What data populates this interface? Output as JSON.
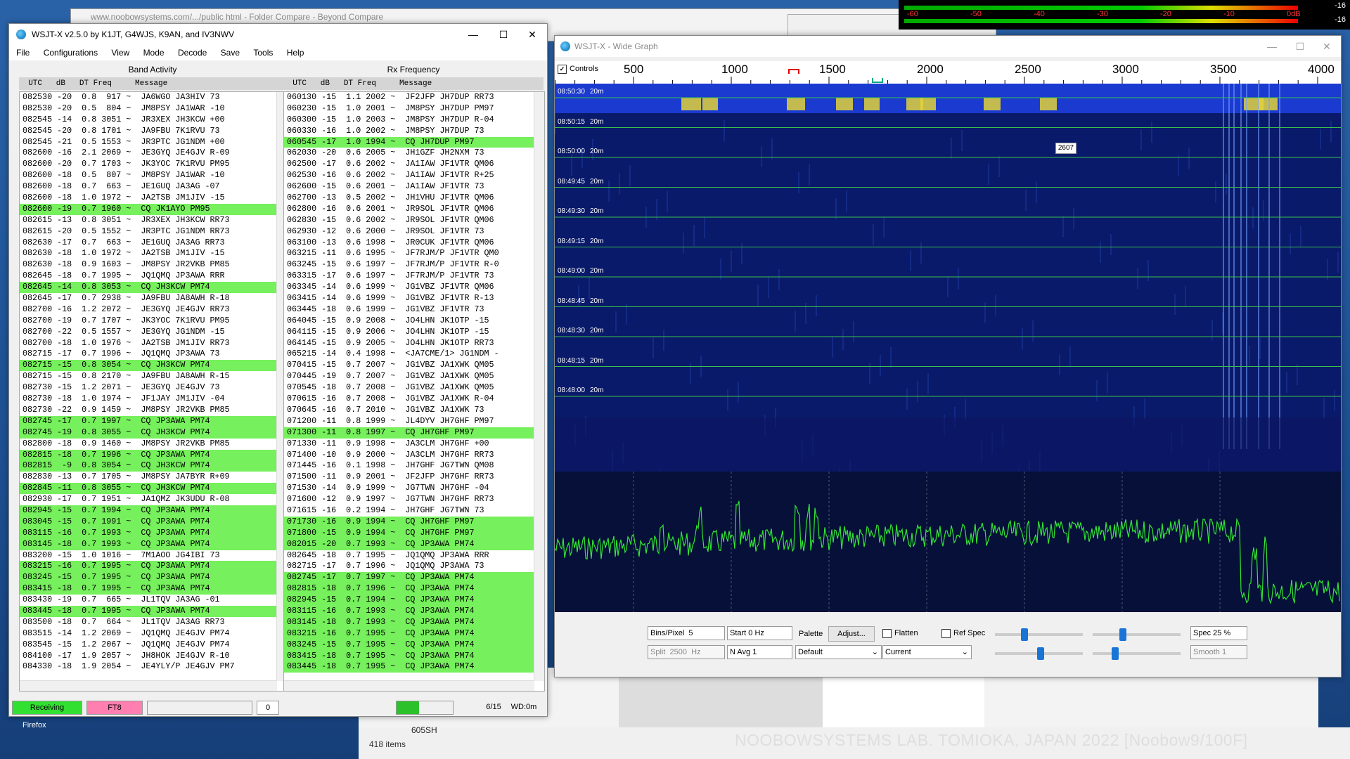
{
  "browser": {
    "title": "www.noobowsystems.com/.../public html - Folder Compare - Beyond Compare"
  },
  "meter": {
    "ticks": [
      "-60",
      "-50",
      "-40",
      "-30",
      "-20",
      "-10",
      "0dB"
    ],
    "right_top": "-16",
    "right_bottom": "-16"
  },
  "desktop": {
    "firefox_label": "Firefox",
    "folder_label": "605SH",
    "items_count": "418 items",
    "watermark": "NOOBOWSYSTEMS LAB. TOMIOKA, JAPAN 2022 [Noobow9/100F]"
  },
  "main": {
    "title": "WSJT-X   v2.5.0   by K1JT, G4WJS, K9AN, and IV3NWV",
    "controls": {
      "minimize": "—",
      "maximize": "☐",
      "close": "✕"
    },
    "menu": [
      "File",
      "Configurations",
      "View",
      "Mode",
      "Decode",
      "Save",
      "Tools",
      "Help"
    ],
    "band_activity_label": "Band Activity",
    "rx_frequency_label": "Rx Frequency",
    "col_header": "  UTC   dB   DT Freq     Message",
    "band_rows": [
      {
        "t": "082530 -20  0.8  917 ~  JA6WGO JA3HIV 73",
        "h": false
      },
      {
        "t": "082530 -20  0.5  804 ~  JM8PSY JA1WAR -10",
        "h": false
      },
      {
        "t": "082545 -14  0.8 3051 ~  JR3XEX JH3KCW +00",
        "h": false
      },
      {
        "t": "082545 -20  0.8 1701 ~  JA9FBU 7K1RVU 73",
        "h": false
      },
      {
        "t": "082545 -21  0.5 1553 ~  JR3PTC JG1NDM +00",
        "h": false
      },
      {
        "t": "082600 -16  2.1 2069 ~  JE3GYQ JE4GJV R-09",
        "h": false
      },
      {
        "t": "082600 -20  0.7 1703 ~  JK3YOC 7K1RVU PM95",
        "h": false
      },
      {
        "t": "082600 -18  0.5  807 ~  JM8PSY JA1WAR -10",
        "h": false
      },
      {
        "t": "082600 -18  0.7  663 ~  JE1GUQ JA3AG -07",
        "h": false
      },
      {
        "t": "082600 -18  1.0 1972 ~  JA2TSB JM1JIV -15",
        "h": false
      },
      {
        "t": "082600 -19  0.7 1960 ~  CQ JK1AYO PM95",
        "h": true
      },
      {
        "t": "082615 -13  0.8 3051 ~  JR3XEX JH3KCW RR73",
        "h": false
      },
      {
        "t": "082615 -20  0.5 1552 ~  JR3PTC JG1NDM RR73",
        "h": false
      },
      {
        "t": "082630 -17  0.7  663 ~  JE1GUQ JA3AG RR73",
        "h": false
      },
      {
        "t": "082630 -18  1.0 1972 ~  JA2TSB JM1JIV -15",
        "h": false
      },
      {
        "t": "082630 -18  0.9 1603 ~  JM8PSY JR2VKB PM85",
        "h": false
      },
      {
        "t": "082645 -18  0.7 1995 ~  JQ1QMQ JP3AWA RRR",
        "h": false
      },
      {
        "t": "082645 -14  0.8 3053 ~  CQ JH3KCW PM74",
        "h": true
      },
      {
        "t": "082645 -17  0.7 2938 ~  JA9FBU JA8AWH R-18",
        "h": false
      },
      {
        "t": "082700 -16  1.2 2072 ~  JE3GYQ JE4GJV RR73",
        "h": false
      },
      {
        "t": "082700 -19  0.7 1707 ~  JK3YOC 7K1RVU PM95",
        "h": false
      },
      {
        "t": "082700 -22  0.5 1557 ~  JE3GYQ JG1NDM -15",
        "h": false
      },
      {
        "t": "082700 -18  1.0 1976 ~  JA2TSB JM1JIV RR73",
        "h": false
      },
      {
        "t": "082715 -17  0.7 1996 ~  JQ1QMQ JP3AWA 73",
        "h": false
      },
      {
        "t": "082715 -15  0.8 3054 ~  CQ JH3KCW PM74",
        "h": true
      },
      {
        "t": "082715 -15  0.8 2170 ~  JA9FBU JA8AWH R-15",
        "h": false
      },
      {
        "t": "082730 -15  1.2 2071 ~  JE3GYQ JE4GJV 73",
        "h": false
      },
      {
        "t": "082730 -18  1.0 1974 ~  JF1JAY JM1JIV -04",
        "h": false
      },
      {
        "t": "082730 -22  0.9 1459 ~  JM8PSY JR2VKB PM85",
        "h": false
      },
      {
        "t": "082745 -17  0.7 1997 ~  CQ JP3AWA PM74",
        "h": true
      },
      {
        "t": "082745 -19  0.8 3055 ~  CQ JH3KCW PM74",
        "h": true
      },
      {
        "t": "082800 -18  0.9 1460 ~  JM8PSY JR2VKB PM85",
        "h": false
      },
      {
        "t": "082815 -18  0.7 1996 ~  CQ JP3AWA PM74",
        "h": true
      },
      {
        "t": "082815  -9  0.8 3054 ~  CQ JH3KCW PM74",
        "h": true
      },
      {
        "t": "082830 -13  0.7 1705 ~  JM8PSY JA7BYR R+09",
        "h": false
      },
      {
        "t": "082845 -11  0.8 3055 ~  CQ JH3KCW PM74",
        "h": true
      },
      {
        "t": "082930 -17  0.7 1951 ~  JA1QMZ JK3UDU R-08",
        "h": false
      },
      {
        "t": "082945 -15  0.7 1994 ~  CQ JP3AWA PM74",
        "h": true
      },
      {
        "t": "083045 -15  0.7 1991 ~  CQ JP3AWA PM74",
        "h": true
      },
      {
        "t": "083115 -16  0.7 1993 ~  CQ JP3AWA PM74",
        "h": true
      },
      {
        "t": "083145 -18  0.7 1993 ~  CQ JP3AWA PM74",
        "h": true
      },
      {
        "t": "083200 -15  1.0 1016 ~  7M1AOO JG4IBI 73",
        "h": false
      },
      {
        "t": "083215 -16  0.7 1995 ~  CQ JP3AWA PM74",
        "h": true
      },
      {
        "t": "083245 -15  0.7 1995 ~  CQ JP3AWA PM74",
        "h": true
      },
      {
        "t": "083415 -18  0.7 1995 ~  CQ JP3AWA PM74",
        "h": true
      },
      {
        "t": "083430 -19  0.7  665 ~  JL1TQV JA3AG -01",
        "h": false
      },
      {
        "t": "083445 -18  0.7 1995 ~  CQ JP3AWA PM74",
        "h": true
      },
      {
        "t": "083500 -18  0.7  664 ~  JL1TQV JA3AG RR73",
        "h": false
      },
      {
        "t": "083515 -14  1.2 2069 ~  JQ1QMQ JE4GJV PM74",
        "h": false
      },
      {
        "t": "083545 -15  1.2 2067 ~  JQ1QMQ JE4GJV PM74",
        "h": false
      },
      {
        "t": "084100 -17  1.9 2057 ~  JH8HOK JE4GJV R-10",
        "h": false
      },
      {
        "t": "084330 -18  1.9 2054 ~  JE4YLY/P JE4GJV PM7",
        "h": false
      }
    ],
    "rx_rows": [
      {
        "t": "060130 -15  1.1 2002 ~  JF2JFP JH7DUP RR73",
        "h": false
      },
      {
        "t": "060230 -15  1.0 2001 ~  JM8PSY JH7DUP PM97",
        "h": false
      },
      {
        "t": "060300 -15  1.0 2003 ~  JM8PSY JH7DUP R-04",
        "h": false
      },
      {
        "t": "060330 -16  1.0 2002 ~  JM8PSY JH7DUP 73",
        "h": false
      },
      {
        "t": "060545 -17  1.0 1994 ~  CQ JH7DUP PM97",
        "h": true
      },
      {
        "t": "062030 -20  0.6 2005 ~  JH1GZF JH2NXM 73",
        "h": false
      },
      {
        "t": "062500 -17  0.6 2002 ~  JA1IAW JF1VTR QM06",
        "h": false
      },
      {
        "t": "062530 -16  0.6 2002 ~  JA1IAW JF1VTR R+25",
        "h": false
      },
      {
        "t": "062600 -15  0.6 2001 ~  JA1IAW JF1VTR 73",
        "h": false
      },
      {
        "t": "062700 -13  0.5 2002 ~  JH1VHU JF1VTR QM06",
        "h": false
      },
      {
        "t": "062800 -16  0.6 2001 ~  JR9SOL JF1VTR QM06",
        "h": false
      },
      {
        "t": "062830 -15  0.6 2002 ~  JR9SOL JF1VTR QM06",
        "h": false
      },
      {
        "t": "062930 -12  0.6 2000 ~  JR9SOL JF1VTR 73",
        "h": false
      },
      {
        "t": "063100 -13  0.6 1998 ~  JR0CUK JF1VTR QM06",
        "h": false
      },
      {
        "t": "063215 -11  0.6 1995 ~  JF7RJM/P JF1VTR QM0",
        "h": false
      },
      {
        "t": "063245 -15  0.6 1997 ~  JF7RJM/P JF1VTR R-0",
        "h": false
      },
      {
        "t": "063315 -17  0.6 1997 ~  JF7RJM/P JF1VTR 73",
        "h": false
      },
      {
        "t": "063345 -14  0.6 1999 ~  JG1VBZ JF1VTR QM06",
        "h": false
      },
      {
        "t": "063415 -14  0.6 1999 ~  JG1VBZ JF1VTR R-13",
        "h": false
      },
      {
        "t": "063445 -18  0.6 1999 ~  JG1VBZ JF1VTR 73",
        "h": false
      },
      {
        "t": "064045 -15  0.9 2008 ~  JO4LHN JK1OTP -15",
        "h": false
      },
      {
        "t": "064115 -15  0.9 2006 ~  JO4LHN JK1OTP -15",
        "h": false
      },
      {
        "t": "064145 -15  0.9 2005 ~  JO4LHN JK1OTP RR73",
        "h": false
      },
      {
        "t": "065215 -14  0.4 1998 ~  <JA7CME/1> JG1NDM -",
        "h": false
      },
      {
        "t": "070415 -15  0.7 2007 ~  JG1VBZ JA1XWK QM05",
        "h": false
      },
      {
        "t": "070445 -19  0.7 2007 ~  JG1VBZ JA1XWK QM05",
        "h": false
      },
      {
        "t": "070545 -18  0.7 2008 ~  JG1VBZ JA1XWK QM05",
        "h": false
      },
      {
        "t": "070615 -16  0.7 2008 ~  JG1VBZ JA1XWK R-04",
        "h": false
      },
      {
        "t": "070645 -16  0.7 2010 ~  JG1VBZ JA1XWK 73",
        "h": false
      },
      {
        "t": "071200 -11  0.8 1999 ~  JL4DYV JH7GHF PM97",
        "h": false
      },
      {
        "t": "071300 -11  0.8 1997 ~  CQ JH7GHF PM97",
        "h": true
      },
      {
        "t": "071330 -11  0.9 1998 ~  JA3CLM JH7GHF +00",
        "h": false
      },
      {
        "t": "071400 -10  0.9 2000 ~  JA3CLM JH7GHF RR73",
        "h": false
      },
      {
        "t": "071445 -16  0.1 1998 ~  JH7GHF JG7TWN QM08",
        "h": false
      },
      {
        "t": "071500 -11  0.9 2001 ~  JF2JFP JH7GHF RR73",
        "h": false
      },
      {
        "t": "071530 -14  0.9 1999 ~  JG7TWN JH7GHF -04",
        "h": false
      },
      {
        "t": "071600 -12  0.9 1997 ~  JG7TWN JH7GHF RR73",
        "h": false
      },
      {
        "t": "071615 -16  0.2 1994 ~  JH7GHF JG7TWN 73",
        "h": false
      },
      {
        "t": "071730 -16  0.9 1994 ~  CQ JH7GHF PM97",
        "h": true
      },
      {
        "t": "071800 -15  0.9 1994 ~  CQ JH7GHF PM97",
        "h": true
      },
      {
        "t": "082015 -20  0.7 1993 ~  CQ JP3AWA PM74",
        "h": true
      },
      {
        "t": "082645 -18  0.7 1995 ~  JQ1QMQ JP3AWA RRR",
        "h": false
      },
      {
        "t": "082715 -17  0.7 1996 ~  JQ1QMQ JP3AWA 73",
        "h": false
      },
      {
        "t": "082745 -17  0.7 1997 ~  CQ JP3AWA PM74",
        "h": true
      },
      {
        "t": "082815 -18  0.7 1996 ~  CQ JP3AWA PM74",
        "h": true
      },
      {
        "t": "082945 -15  0.7 1994 ~  CQ JP3AWA PM74",
        "h": true
      },
      {
        "t": "083115 -16  0.7 1993 ~  CQ JP3AWA PM74",
        "h": true
      },
      {
        "t": "083145 -18  0.7 1993 ~  CQ JP3AWA PM74",
        "h": true
      },
      {
        "t": "083215 -16  0.7 1995 ~  CQ JP3AWA PM74",
        "h": true
      },
      {
        "t": "083245 -15  0.7 1995 ~  CQ JP3AWA PM74",
        "h": true
      },
      {
        "t": "083415 -18  0.7 1995 ~  CQ JP3AWA PM74",
        "h": true
      },
      {
        "t": "083445 -18  0.7 1995 ~  CQ JP3AWA PM74",
        "h": true
      }
    ],
    "status": {
      "receiving": "Receiving",
      "mode": "FT8",
      "count": "0",
      "progress_text": "6/15",
      "wd": "WD:0m",
      "progress": 0.4
    },
    "colors": {
      "highlight": "#76f05c",
      "receiving_bg": "#32e032",
      "mode_bg": "#ff7fb0"
    }
  },
  "wide_graph": {
    "title": "WSJT-X - Wide Graph",
    "controls_label": "Controls",
    "scale": [
      "500",
      "1000",
      "1500",
      "2000",
      "2500",
      "3000",
      "3500",
      "4000"
    ],
    "time_labels": [
      "08:50:30",
      "08:50:15",
      "08:50:00",
      "08:49:45",
      "08:49:30",
      "08:49:15",
      "08:49:00",
      "08:48:45",
      "08:48:30",
      "08:48:15",
      "08:48:00"
    ],
    "band_label": "20m",
    "tooltip": "2607",
    "bins_label": "Bins/Pixel",
    "bins_value": "5",
    "start_value": "Start 0 Hz",
    "split_label": "Split",
    "split_value": "2500",
    "split_unit": "Hz",
    "navg_value": "N Avg  1",
    "palette_label": "Palette",
    "adjust_button": "Adjust...",
    "palette_value": "Default",
    "flatten_label": "Flatten",
    "refspec_label": "Ref Spec",
    "spectrum_value": "Current",
    "spec_value": "Spec  25 %",
    "smooth_value": "Smooth  1"
  }
}
